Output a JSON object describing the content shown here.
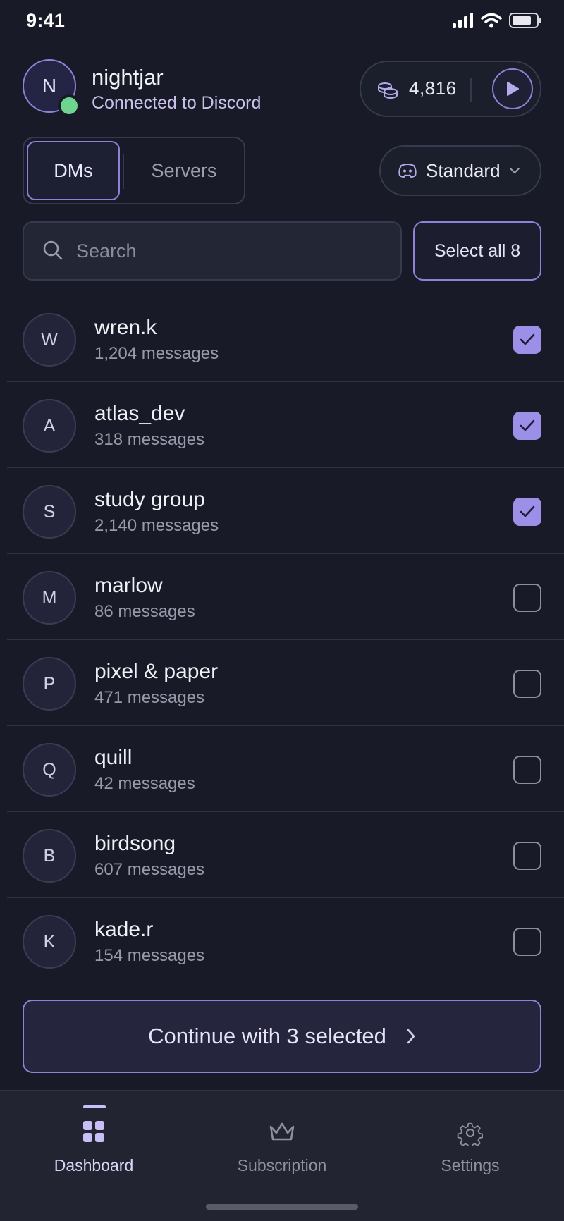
{
  "status_bar": {
    "time": "9:41"
  },
  "profile": {
    "initial": "N",
    "username": "nightjar",
    "connection_status": "Connected to Discord"
  },
  "balance": {
    "coins": "4,816"
  },
  "tabs": {
    "dms": "DMs",
    "servers": "Servers",
    "selected": "DMs"
  },
  "mode": {
    "label": "Standard"
  },
  "search": {
    "placeholder": "Search",
    "value": ""
  },
  "select_all": {
    "label": "Select all 8"
  },
  "chats": [
    {
      "initial": "W",
      "name": "wren.k",
      "count": "1,204 messages",
      "checked": true
    },
    {
      "initial": "A",
      "name": "atlas_dev",
      "count": "318 messages",
      "checked": true
    },
    {
      "initial": "S",
      "name": "study group",
      "count": "2,140 messages",
      "checked": true
    },
    {
      "initial": "M",
      "name": "marlow",
      "count": "86 messages",
      "checked": false
    },
    {
      "initial": "P",
      "name": "pixel & paper",
      "count": "471 messages",
      "checked": false
    },
    {
      "initial": "Q",
      "name": "quill",
      "count": "42 messages",
      "checked": false
    },
    {
      "initial": "B",
      "name": "birdsong",
      "count": "607 messages",
      "checked": false
    },
    {
      "initial": "K",
      "name": "kade.r",
      "count": "154 messages",
      "checked": false
    }
  ],
  "continue": {
    "label": "Continue with 3 selected"
  },
  "nav": {
    "dashboard": "Dashboard",
    "subscription": "Subscription",
    "settings": "Settings",
    "active": "Dashboard"
  },
  "colors": {
    "background": "#181b27",
    "accent": "#8f80d8",
    "checkbox_checked": "#9c8fe8",
    "online": "#6fd48f",
    "tab_bar": "#222431"
  },
  "icons": {
    "coins": "coins-icon",
    "play": "play-icon",
    "mode": "discord-icon",
    "search": "search-icon",
    "dashboard": "grid-icon",
    "subscription": "crown-icon",
    "settings": "gear-icon"
  }
}
